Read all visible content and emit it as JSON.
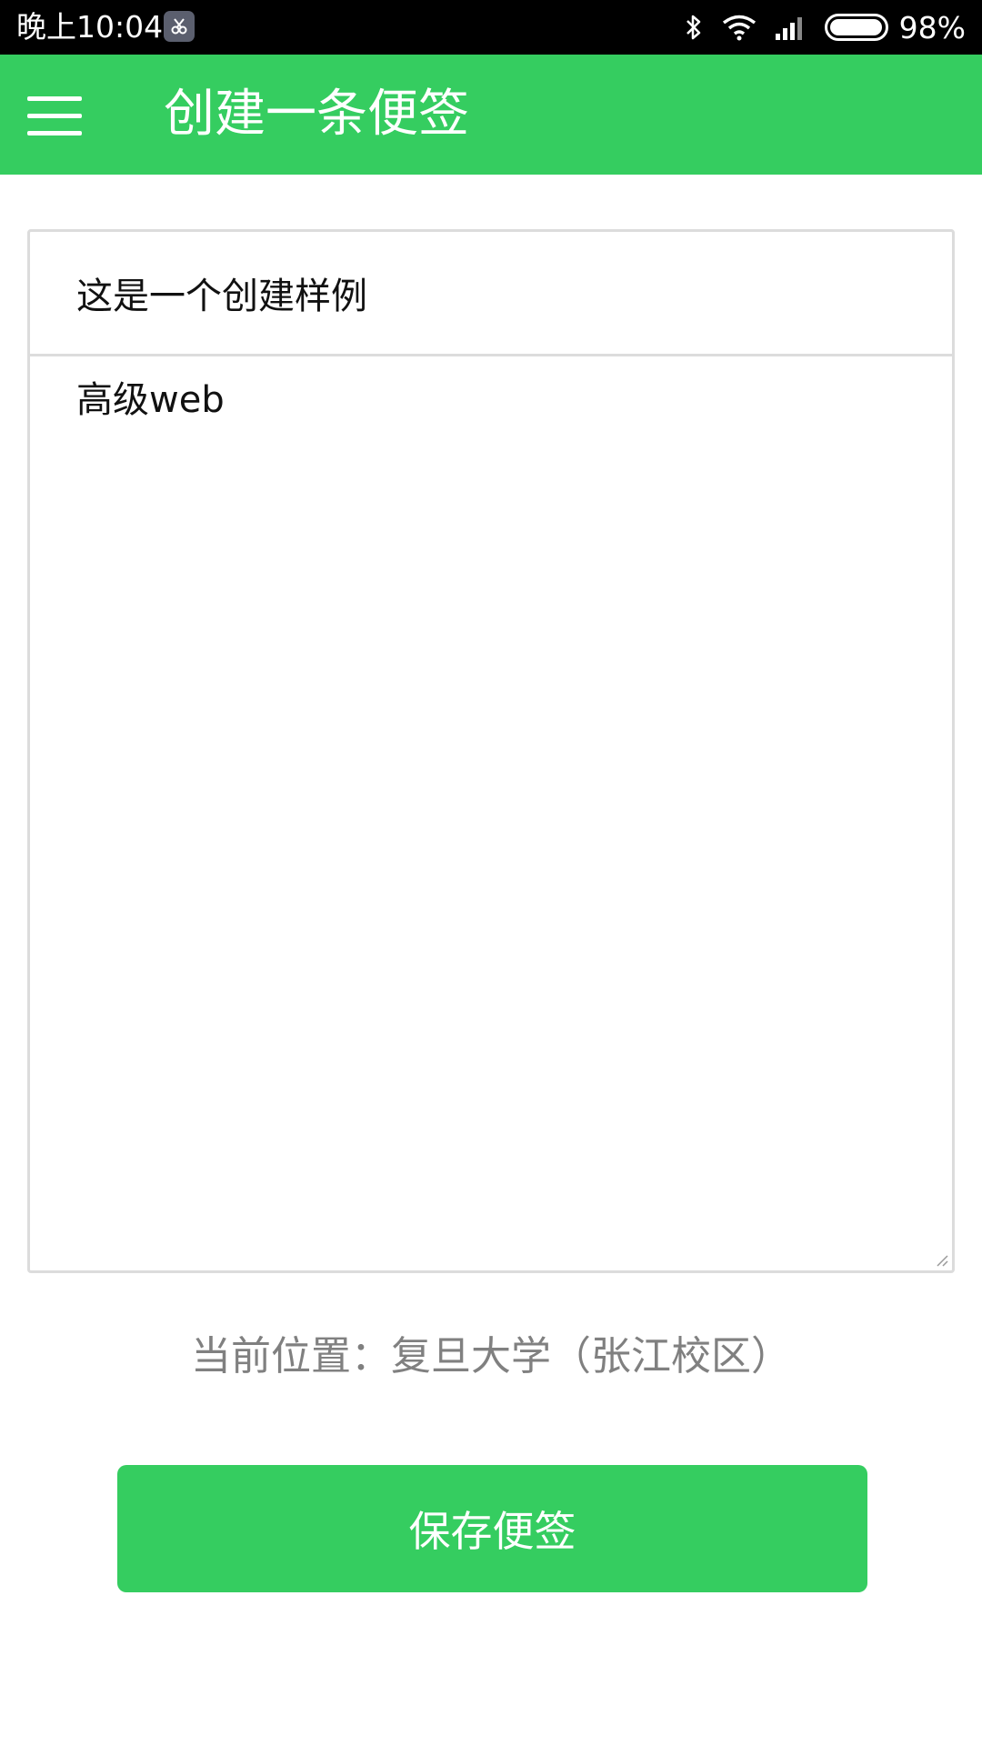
{
  "status_bar": {
    "time": "晚上10:04",
    "battery_percent_text": "98%",
    "battery_level": 0.98,
    "icons": [
      "app-notification-icon",
      "bluetooth-icon",
      "wifi-icon",
      "cellular-signal-icon",
      "battery-icon"
    ]
  },
  "app_bar": {
    "title": "创建一条便签",
    "menu_icon": "hamburger-menu-icon",
    "background_color": "#35cd60"
  },
  "form": {
    "title_value": "这是一个创建样例",
    "content_value": "高级web"
  },
  "location": {
    "text": "当前位置：复旦大学（张江校区）"
  },
  "save_button": {
    "label": "保存便签",
    "color": "#35cd60"
  }
}
